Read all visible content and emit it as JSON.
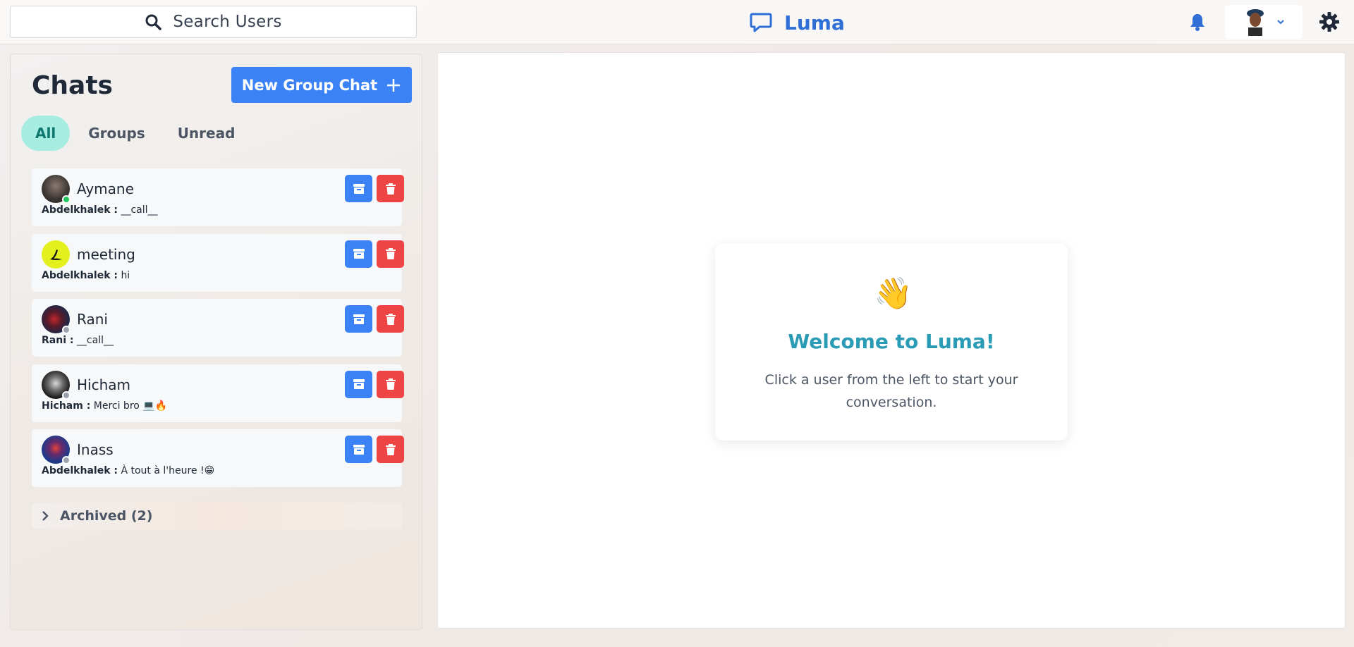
{
  "search": {
    "placeholder": "Search Users"
  },
  "brand": {
    "name": "Luma",
    "accent": "#2f6fd6"
  },
  "header": {
    "notification_icon": "bell-icon",
    "settings_icon": "gear-icon",
    "profile_icon": "chevron-down-icon"
  },
  "sidebar": {
    "title": "Chats",
    "new_group_label": "New Group Chat",
    "tabs": [
      {
        "label": "All",
        "active": true
      },
      {
        "label": "Groups",
        "active": false
      },
      {
        "label": "Unread",
        "active": false
      }
    ],
    "chats": [
      {
        "name": "Aymane",
        "sender": "Abdelkhalek :",
        "message": "__call__",
        "status": "online"
      },
      {
        "name": "meeting",
        "sender": "Abdelkhalek :",
        "message": "hi",
        "status": "none"
      },
      {
        "name": "Rani",
        "sender": "Rani :",
        "message": "__call__",
        "status": "offline"
      },
      {
        "name": "Hicham",
        "sender": "Hicham :",
        "message": "Merci bro 💻🔥",
        "status": "offline"
      },
      {
        "name": "Inass",
        "sender": "Abdelkhalek :",
        "message": "À tout à l'heure !😁",
        "status": "offline"
      }
    ],
    "archived_label": "Archived (2)"
  },
  "welcome": {
    "emoji": "👋",
    "title": "Welcome to Luma!",
    "subtitle": "Click a user from the left to start your conversation."
  },
  "colors": {
    "primary": "#3b82f6",
    "danger": "#ef4444",
    "online": "#22c55e",
    "offline": "#9ca3af",
    "tab_active": "#a7ece0"
  }
}
